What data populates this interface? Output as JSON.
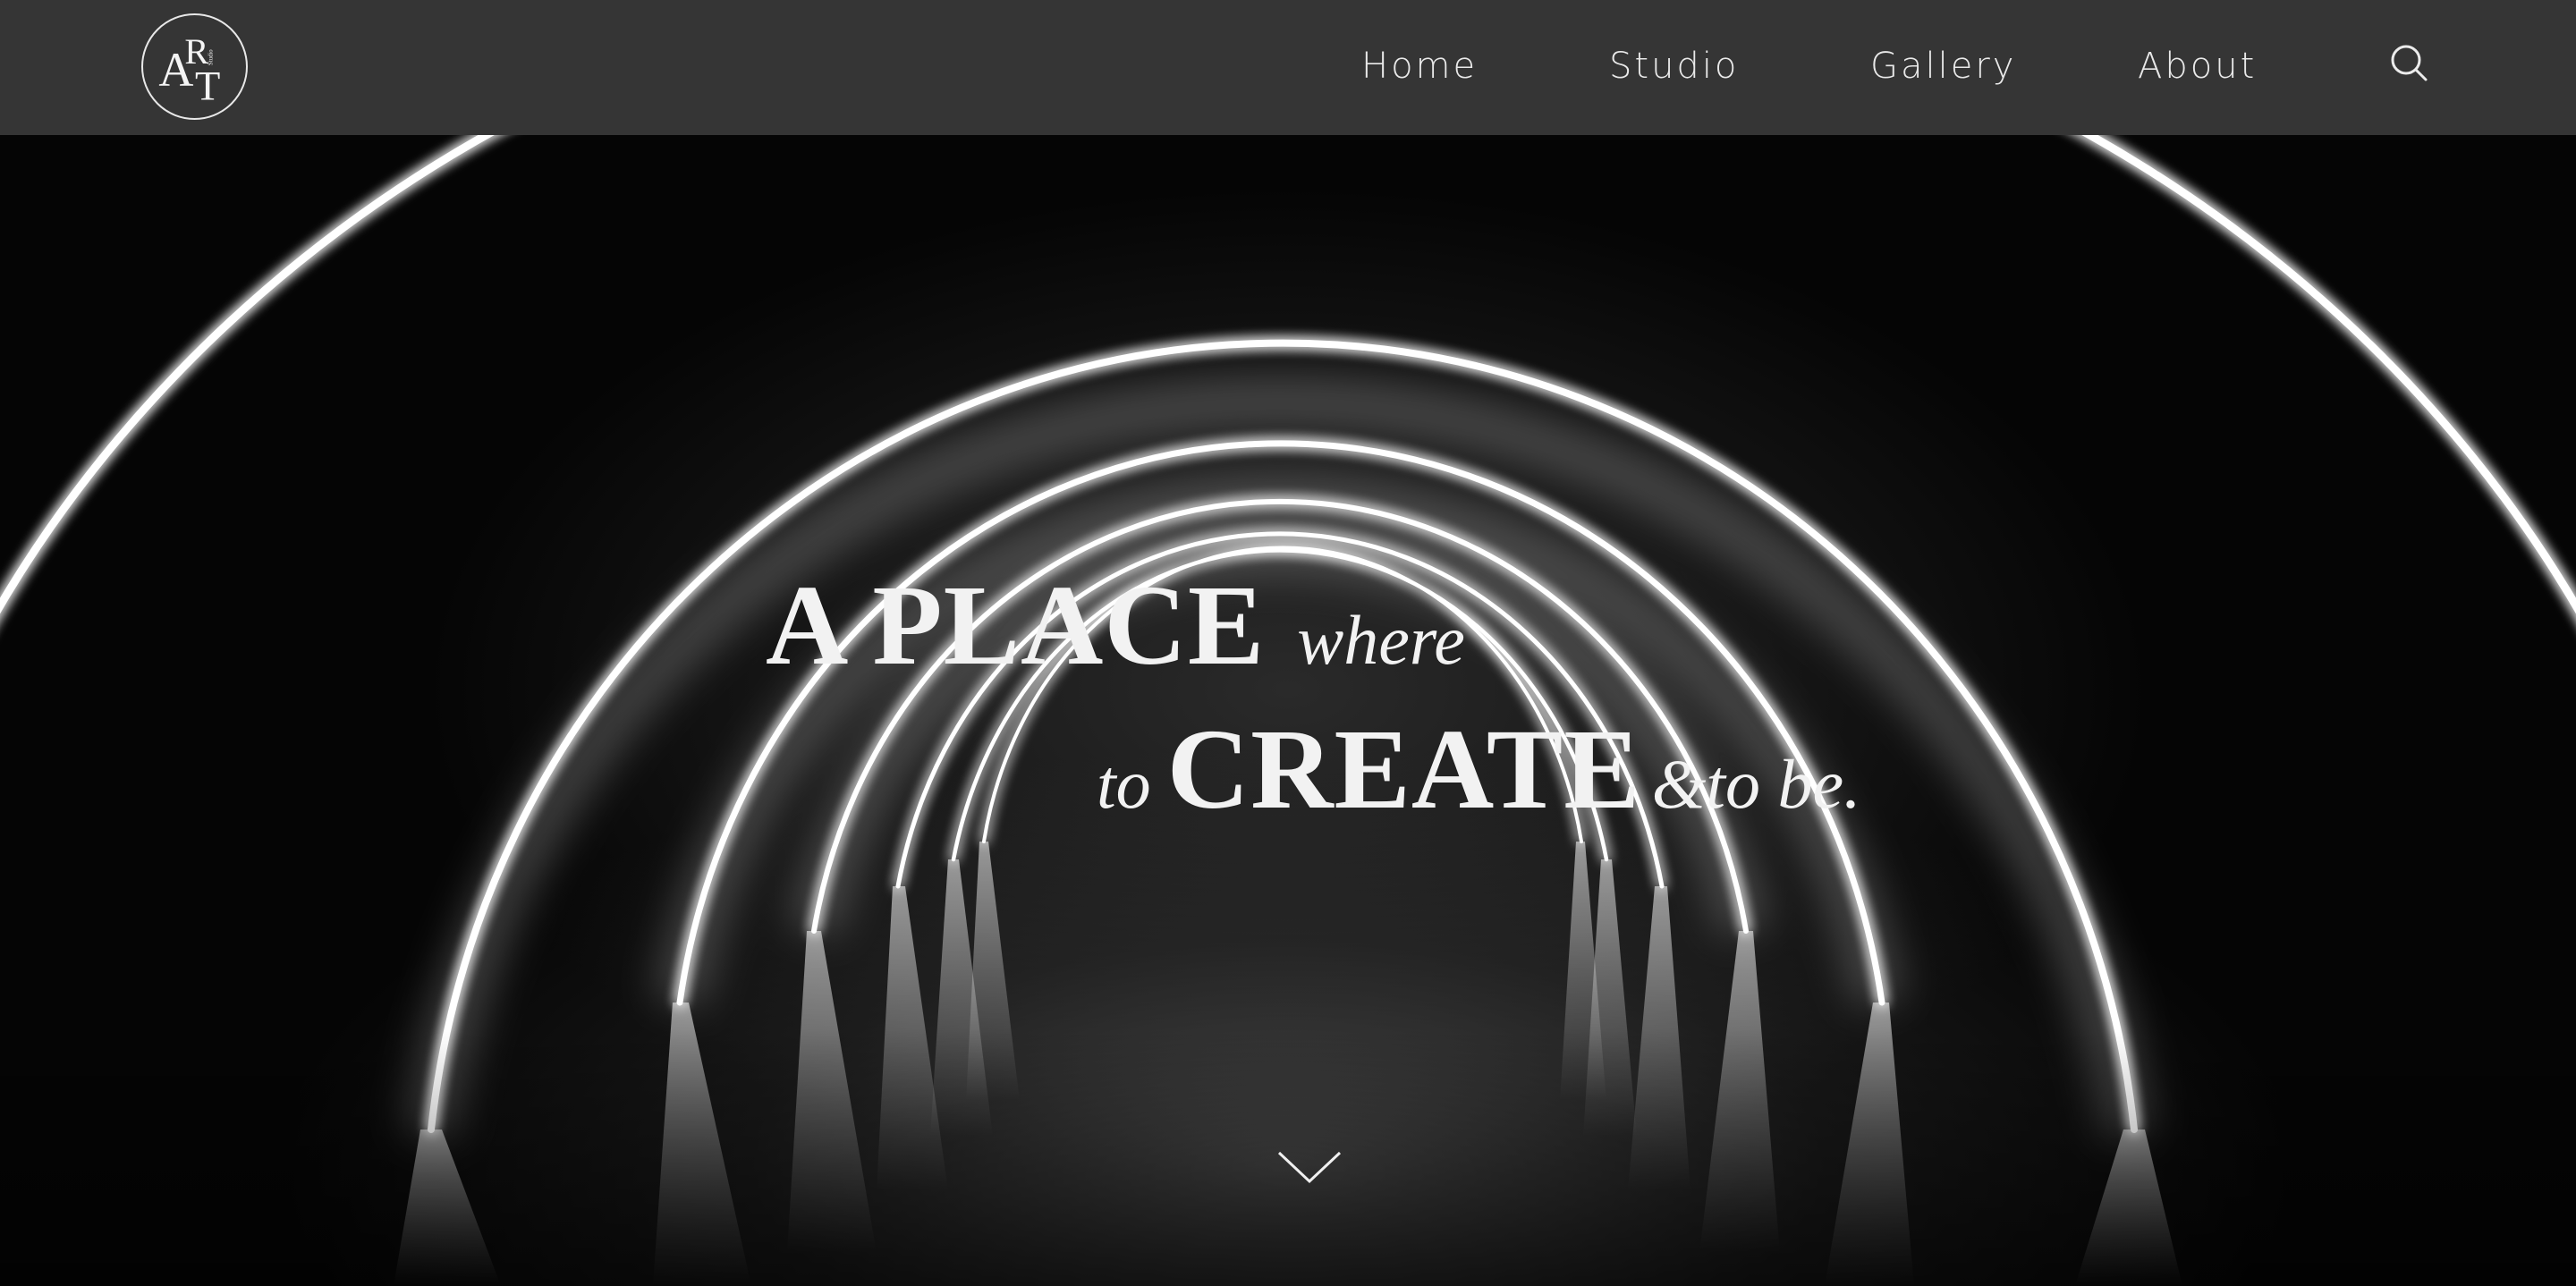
{
  "header": {
    "logo": {
      "letters": [
        "A",
        "R",
        "T"
      ],
      "small_text": "Studio",
      "icon": "art-logo-icon"
    },
    "nav": {
      "items": [
        {
          "label": "Home"
        },
        {
          "label": "Studio"
        },
        {
          "label": "Gallery"
        },
        {
          "label": "About"
        }
      ]
    },
    "search_icon": "search-icon"
  },
  "hero": {
    "headline": {
      "line1_big": "A PLACE",
      "line1_italic": "where",
      "line2_italic_prefix": "to",
      "line2_big": "CREATE",
      "line2_italic_suffix": "&to be."
    },
    "scroll_icon": "chevron-down-icon"
  },
  "colors": {
    "header_bg": "#353535",
    "text": "#f2f2f2",
    "hero_bg": "#050505",
    "arch_light": "#ffffff"
  }
}
